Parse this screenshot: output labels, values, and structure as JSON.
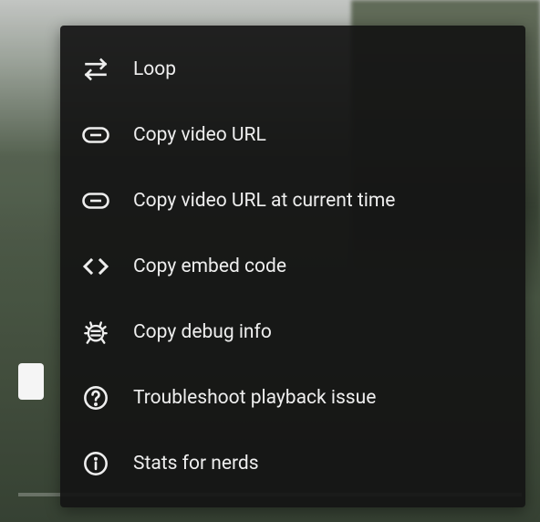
{
  "context_menu": {
    "items": [
      {
        "icon": "loop-icon",
        "label": "Loop"
      },
      {
        "icon": "link-icon",
        "label": "Copy video URL"
      },
      {
        "icon": "link-icon",
        "label": "Copy video URL at current time"
      },
      {
        "icon": "embed-icon",
        "label": "Copy embed code"
      },
      {
        "icon": "bug-icon",
        "label": "Copy debug info"
      },
      {
        "icon": "help-circle-icon",
        "label": "Troubleshoot playback issue"
      },
      {
        "icon": "info-circle-icon",
        "label": "Stats for nerds"
      }
    ]
  }
}
